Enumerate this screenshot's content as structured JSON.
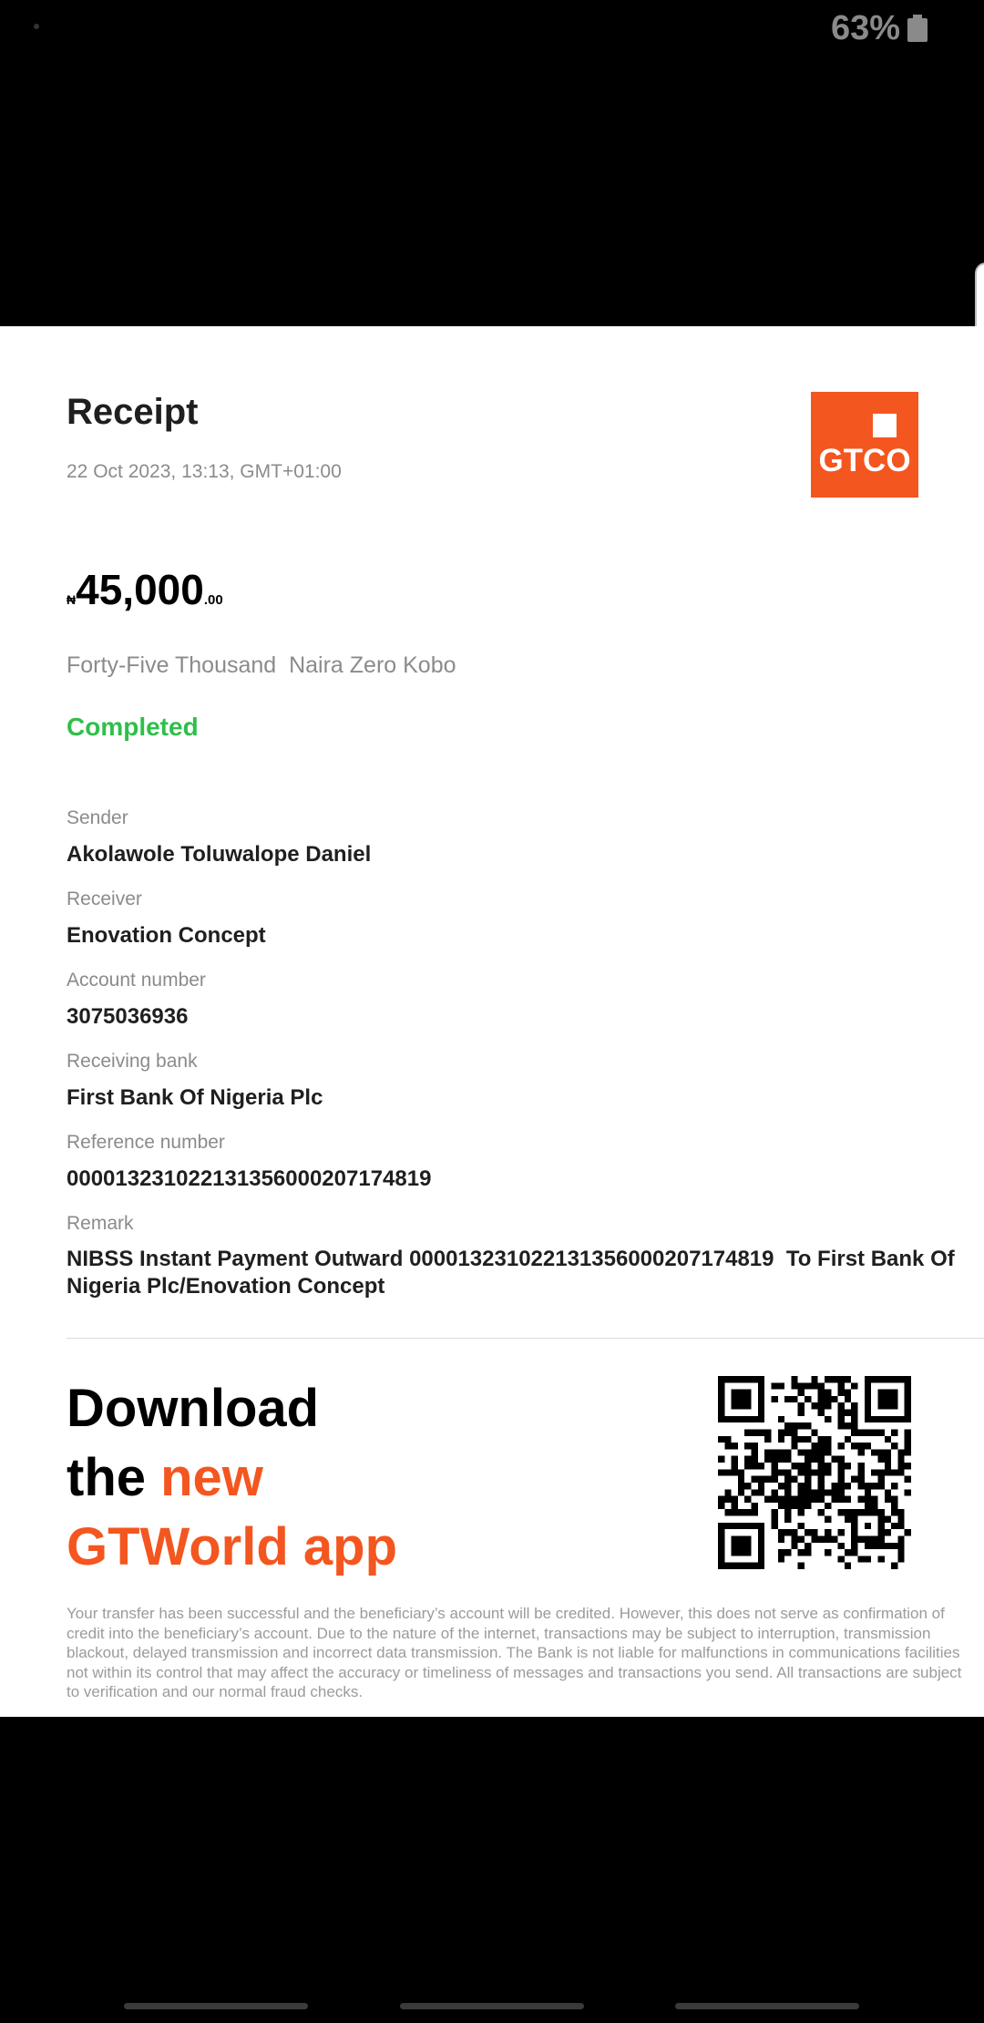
{
  "status_bar": {
    "battery": "63%"
  },
  "receipt": {
    "title": "Receipt",
    "date": "22 Oct 2023, 13:13, GMT+01:00",
    "logo_text": "GTCO",
    "amount": {
      "currency": "₦",
      "main": "45,000",
      "kobo": ".00"
    },
    "amount_words": "Forty-Five Thousand  Naira Zero Kobo",
    "status": "Completed",
    "fields": {
      "sender": {
        "label": "Sender",
        "value": "Akolawole Toluwalope Daniel"
      },
      "receiver": {
        "label": "Receiver",
        "value": "Enovation Concept"
      },
      "account_number": {
        "label": "Account number",
        "value": "3075036936"
      },
      "receiving_bank": {
        "label": "Receiving bank",
        "value": "First Bank Of Nigeria Plc"
      },
      "reference_number": {
        "label": "Reference number",
        "value": "000013231022131356000207174819"
      },
      "remark": {
        "label": "Remark",
        "value": "NIBSS Instant Payment Outward 000013231022131356000207174819  To First Bank Of Nigeria Plc/Enovation Concept"
      }
    }
  },
  "promo": {
    "line1": "Download",
    "line2_a": "the ",
    "line2_b": "new",
    "line3": "GTWorld app"
  },
  "disclaimer": "Your transfer has been successful and the beneficiary’s account will be credited. However, this does not serve as confirmation of credit into the beneficiary’s account. Due to the nature of the internet, transactions may be subject to interruption, transmission blackout, delayed transmission and incorrect data transmission. The Bank is not liable for malfunctions in communications facilities not within its control that may affect the accuracy or timeliness of messages and transactions you send. All transactions are subject to verification and our normal fraud checks.",
  "colors": {
    "brand": "#f4561f",
    "success": "#2fbf4a"
  },
  "icons": [
    "battery-icon",
    "qr-code-icon",
    "gtco-logo"
  ]
}
